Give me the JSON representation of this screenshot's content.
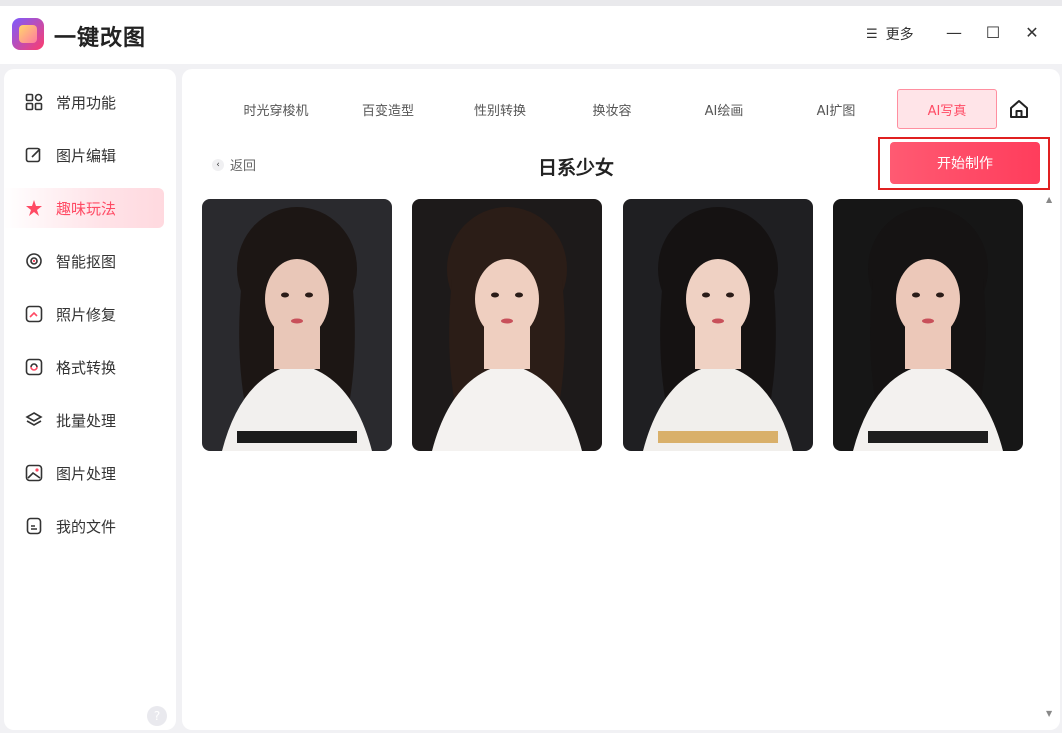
{
  "app": {
    "title": "一键改图",
    "more_label": "更多",
    "more_icon": "menu-lines-icon"
  },
  "window_controls": {
    "minimize": "—",
    "maximize": "☐",
    "close": "✕"
  },
  "sidebar": {
    "items": [
      {
        "label": "常用功能",
        "icon": "grid-icon",
        "active": false
      },
      {
        "label": "图片编辑",
        "icon": "edit-icon",
        "active": false
      },
      {
        "label": "趣味玩法",
        "icon": "star-icon",
        "active": true
      },
      {
        "label": "智能抠图",
        "icon": "target-icon",
        "active": false
      },
      {
        "label": "照片修复",
        "icon": "repair-icon",
        "active": false
      },
      {
        "label": "格式转换",
        "icon": "convert-icon",
        "active": false
      },
      {
        "label": "批量处理",
        "icon": "layers-icon",
        "active": false
      },
      {
        "label": "图片处理",
        "icon": "image-icon",
        "active": false
      },
      {
        "label": "我的文件",
        "icon": "file-icon",
        "active": false
      }
    ],
    "help_glyph": "?"
  },
  "tabs": [
    {
      "label": "时光穿梭机",
      "active": false
    },
    {
      "label": "百变造型",
      "active": false
    },
    {
      "label": "性别转换",
      "active": false
    },
    {
      "label": "换妆容",
      "active": false
    },
    {
      "label": "AI绘画",
      "active": false
    },
    {
      "label": "AI扩图",
      "active": false
    },
    {
      "label": "AI写真",
      "active": true
    }
  ],
  "page": {
    "back_label": "返回",
    "title": "日系少女",
    "start_button": "开始制作"
  },
  "gallery": [
    {
      "name": "portrait-1",
      "bg": "#2a2a2e",
      "skin": "#e9c7b8",
      "hair": "#1c1614",
      "robe": "#f2f0ee",
      "sash": "#1b1b1b"
    },
    {
      "name": "portrait-2",
      "bg": "#1d1a1a",
      "skin": "#efcfc0",
      "hair": "#2b1d17",
      "robe": "#f4f2f0",
      "sash": "#f4f2f0"
    },
    {
      "name": "portrait-3",
      "bg": "#1f1f22",
      "skin": "#efd1c3",
      "hair": "#151212",
      "robe": "#f1efec",
      "sash": "#d9b06a"
    },
    {
      "name": "portrait-4",
      "bg": "#161616",
      "skin": "#ecc8b9",
      "hair": "#151313",
      "robe": "#f3f1ef",
      "sash": "#1e1e1e"
    }
  ],
  "colors": {
    "accent": "#ff4a64",
    "highlight_frame": "#e02020"
  }
}
